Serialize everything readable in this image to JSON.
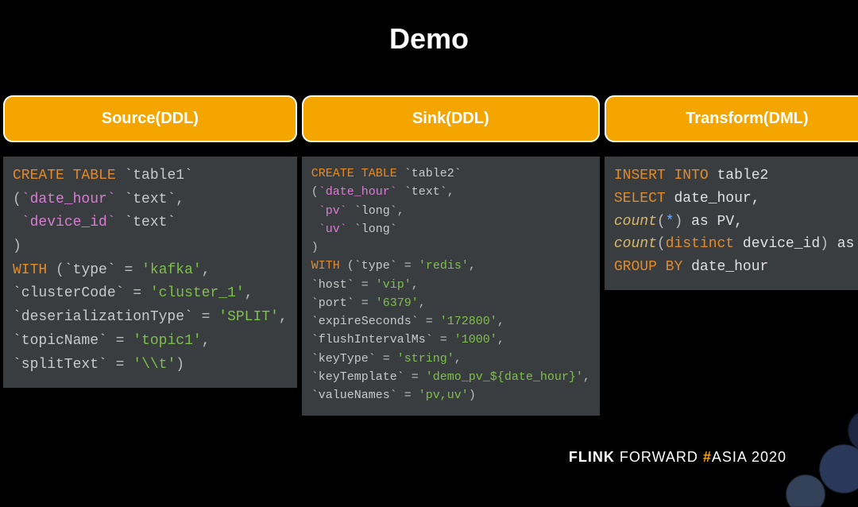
{
  "title": "Demo",
  "columns": [
    {
      "header": "Source(DDL)"
    },
    {
      "header": "Sink(DDL)"
    },
    {
      "header": "Transform(DML)"
    }
  ],
  "source_code": {
    "create": "CREATE TABLE",
    "table": "`table1`",
    "col1_name": "`date_hour`",
    "col1_type": "`text`",
    "col2_name": "`device_id`",
    "col2_type": "`text`",
    "with_kw": "WITH",
    "opts": [
      {
        "k": "`type`",
        "v": "'kafka'"
      },
      {
        "k": "`clusterCode`",
        "v": "'cluster_1'"
      },
      {
        "k": "`deserializationType`",
        "v": "'SPLIT'"
      },
      {
        "k": "`topicName`",
        "v": "'topic1'"
      },
      {
        "k": "`splitText`",
        "v": "'\\\\t'"
      }
    ]
  },
  "sink_code": {
    "create": "CREATE TABLE",
    "table": "`table2`",
    "cols": [
      {
        "n": "`date_hour`",
        "t": "`text`"
      },
      {
        "n": "`pv`",
        "t": "`long`"
      },
      {
        "n": "`uv`",
        "t": "`long`"
      }
    ],
    "with_kw": "WITH",
    "opts": [
      {
        "k": "`type`",
        "v": "'redis'"
      },
      {
        "k": "`host`",
        "v": "'vip'"
      },
      {
        "k": "`port`",
        "v": "'6379'"
      },
      {
        "k": "`expireSeconds`",
        "v": "'172800'"
      },
      {
        "k": "`flushIntervalMs`",
        "v": "'1000'"
      },
      {
        "k": "`keyType`",
        "v": "'string'"
      },
      {
        "k": "`keyTemplate`",
        "v": "'demo_pv_${date_hour}'"
      },
      {
        "k": "`valueNames`",
        "v": "'pv,uv'"
      }
    ]
  },
  "transform_code": {
    "l1a": "INSERT INTO",
    "l1b": "table2",
    "l2a": "SELECT",
    "l2b": "date_hour,",
    "l3a": "count",
    "l3b": "(",
    "l3c": "*",
    "l3d": ")",
    "l3e": " as PV,",
    "l4a": "count",
    "l4b": "(",
    "l4c": "distinct",
    "l4d": " device_id",
    "l4e": ")",
    "l4f": " as uv",
    "l5a": "GROUP BY",
    "l5b": "date_hour"
  },
  "footer": {
    "flink": "FLINK",
    "forward": "FORWARD ",
    "hash": "#",
    "asia": "ASIA 2020"
  }
}
